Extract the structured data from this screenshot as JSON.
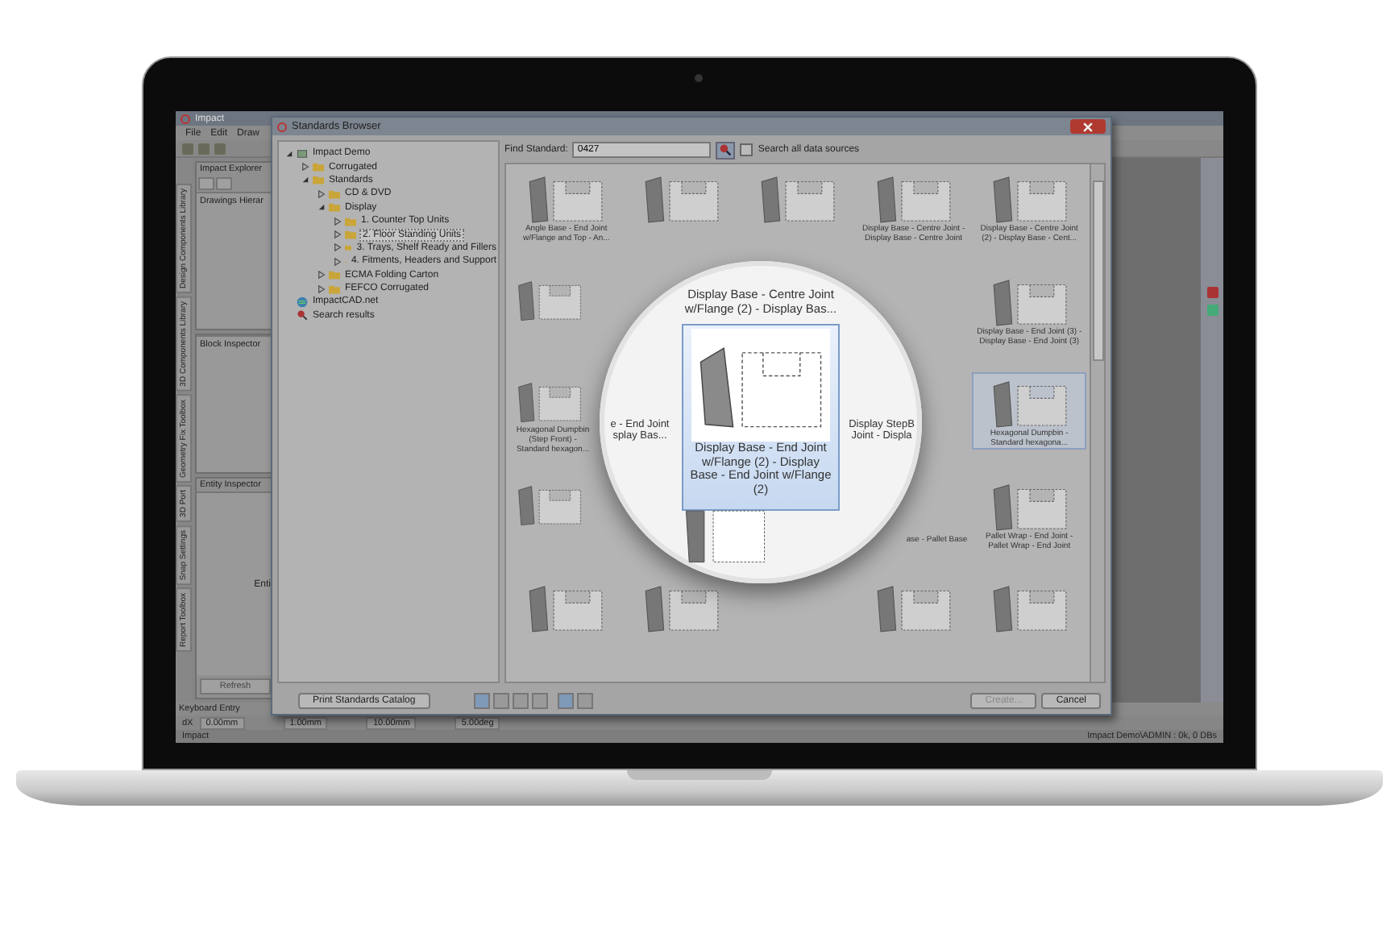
{
  "app": {
    "title": "Impact",
    "menu": [
      "File",
      "Edit",
      "Draw"
    ],
    "side_tabs": [
      "Design Components Library",
      "3D Components Library",
      "Geometry Fix Toolbox",
      "3D Port",
      "Snap Settings",
      "Report Toolbox"
    ],
    "explorer_title": "Impact Explorer",
    "hierarchy_title": "Drawings Hierar",
    "block_inspector": "Block Inspector",
    "entity_inspector": "Entity Inspector",
    "entity_text": "Enti",
    "refresh_button": "Refresh",
    "keyboard_entry": "Keyboard Entry",
    "entry_label": "dX",
    "entry_value": "0.00mm",
    "toolbar_values": [
      "1.00mm",
      "10.00mm",
      "5.00deg"
    ],
    "status": {
      "left": "Impact",
      "right": "Impact Demo\\ADMIN : 0k, 0 DBs"
    }
  },
  "dialog": {
    "title": "Standards Browser",
    "tree": [
      {
        "label": "Impact Demo",
        "kind": "root",
        "expanded": true,
        "selected": false,
        "children": [
          {
            "label": "Corrugated",
            "kind": "folder",
            "expanded": false,
            "selected": false
          },
          {
            "label": "Standards",
            "kind": "folder",
            "expanded": true,
            "selected": false,
            "children": [
              {
                "label": "CD & DVD",
                "kind": "folder",
                "expanded": false,
                "selected": false
              },
              {
                "label": "Display",
                "kind": "folder",
                "expanded": true,
                "selected": false,
                "children": [
                  {
                    "label": "1. Counter Top Units",
                    "kind": "folder",
                    "expanded": false,
                    "selected": false
                  },
                  {
                    "label": "2. Floor Standing Units",
                    "kind": "folder",
                    "expanded": false,
                    "selected": true
                  },
                  {
                    "label": "3. Trays, Shelf Ready and Fillers",
                    "kind": "folder",
                    "expanded": false,
                    "selected": false
                  },
                  {
                    "label": "4. Fitments, Headers and Support",
                    "kind": "folder",
                    "expanded": false,
                    "selected": false
                  }
                ]
              },
              {
                "label": "ECMA Folding Carton",
                "kind": "folder",
                "expanded": false,
                "selected": false
              },
              {
                "label": "FEFCO Corrugated",
                "kind": "folder",
                "expanded": false,
                "selected": false
              }
            ]
          }
        ]
      },
      {
        "label": "ImpactCAD.net",
        "kind": "web",
        "selected": false
      },
      {
        "label": "Search results",
        "kind": "search",
        "selected": false
      }
    ],
    "find_label": "Find Standard:",
    "find_value": "0427",
    "search_all": {
      "label": "Search all data sources",
      "checked": false
    },
    "grid": [
      {
        "kind": "item",
        "label": "Angle Base - End Joint w/Flange and Top - An...",
        "selected": false
      },
      {
        "kind": "item",
        "selected": false
      },
      {
        "kind": "item",
        "selected": false
      },
      {
        "kind": "item",
        "label": "Display Base - Centre Joint - Display Base - Centre Joint",
        "selected": false
      },
      {
        "kind": "item",
        "label": "Display Base - Centre Joint (2) - Display Base - Cent...",
        "selected": false
      },
      {
        "kind": "partial"
      },
      {
        "kind": "hidden"
      },
      {
        "kind": "hidden"
      },
      {
        "kind": "hidden"
      },
      {
        "kind": "item",
        "label": "Display Base - End Joint (3) - Display Base - End Joint (3)",
        "selected": false
      },
      {
        "kind": "partial",
        "label": "Hexagonal Dumpbin (Step Front) - Standard hexagon..."
      },
      {
        "kind": "hidden"
      },
      {
        "kind": "hidden"
      },
      {
        "kind": "hidden"
      },
      {
        "kind": "item",
        "label": "Hexagonal Dumpbin - Standard hexagona...",
        "selected": true
      },
      {
        "kind": "partial"
      },
      {
        "kind": "hidden"
      },
      {
        "kind": "hidden"
      },
      {
        "kind": "caption",
        "label": "ase - Pallet Base"
      },
      {
        "kind": "item",
        "label": "Pallet Wrap - End Joint - Pallet Wrap - End Joint",
        "selected": false
      },
      {
        "kind": "item",
        "selected": false
      },
      {
        "kind": "item",
        "selected": false
      },
      {
        "kind": "hidden"
      },
      {
        "kind": "item",
        "selected": false
      },
      {
        "kind": "item",
        "selected": false
      }
    ],
    "magnifier": [
      {
        "kind": "empty"
      },
      {
        "kind": "label",
        "label": "Display Base - Centre Joint w/Flange (2) - Display Bas..."
      },
      {
        "kind": "empty"
      },
      {
        "kind": "side",
        "label": "e - End Joint splay Bas..."
      },
      {
        "kind": "cell",
        "label": "Display Base - End Joint w/Flange (2) - Display Base - End Joint w/Flange (2)",
        "selected": true
      },
      {
        "kind": "side",
        "label": "Display StepB Joint - Displa"
      },
      {
        "kind": "empty"
      },
      {
        "kind": "thumb"
      },
      {
        "kind": "empty"
      }
    ],
    "print_button": "Print Standards Catalog",
    "create_button": {
      "label": "Create...",
      "disabled": true
    },
    "cancel_button": "Cancel"
  }
}
